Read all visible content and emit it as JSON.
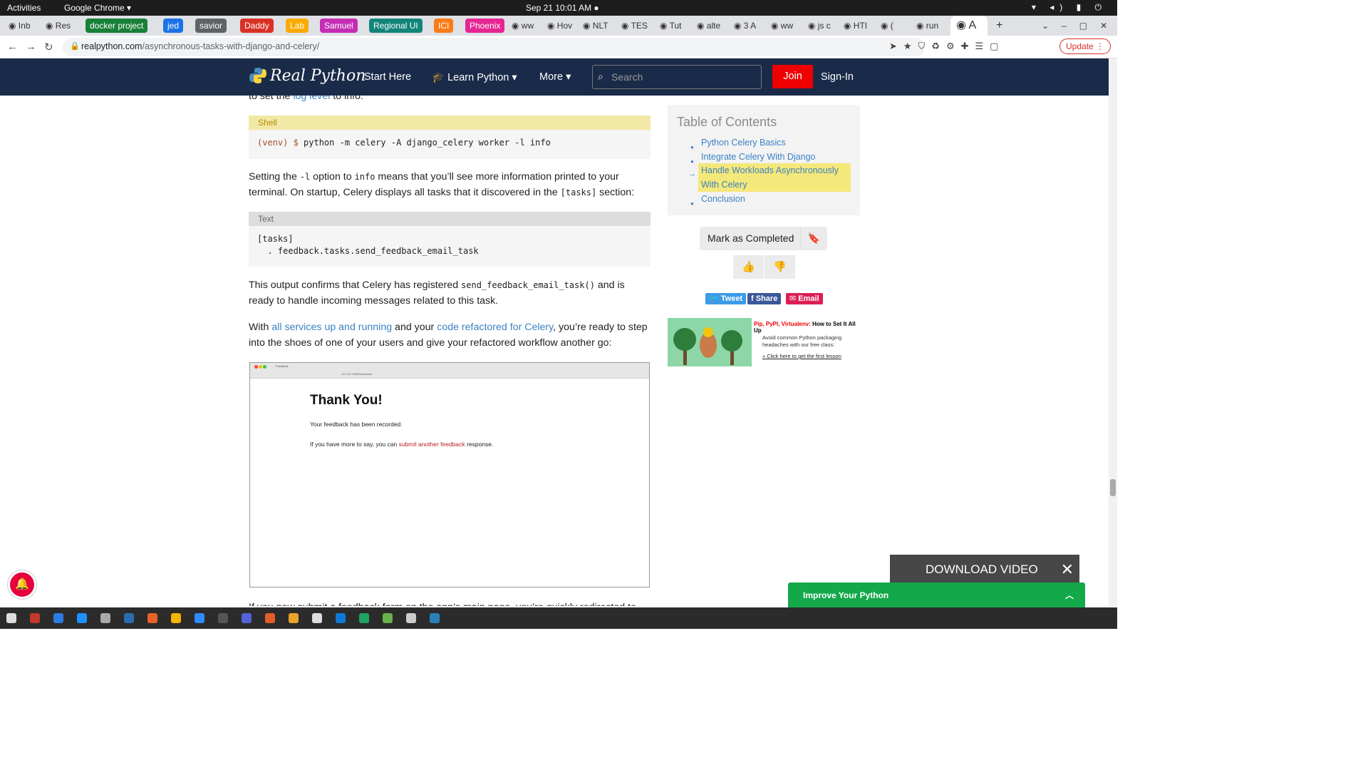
{
  "system": {
    "activities": "Activities",
    "app": "Google Chrome ▾",
    "clock": "Sep 21  10:01 AM  ●",
    "tray": "▾ ◂) ▮ ⏻"
  },
  "tabs": [
    {
      "label": "Inb",
      "icon": "gmail-icon"
    },
    {
      "label": "Res",
      "icon": "drive-icon"
    },
    {
      "label": "docker project",
      "group": true,
      "color": "#188038"
    },
    {
      "label": "jed",
      "group": true,
      "color": "#1a73e8"
    },
    {
      "label": "savior",
      "group": true,
      "color": "#5f6368"
    },
    {
      "label": "Daddy",
      "group": true,
      "color": "#d93025"
    },
    {
      "label": "Lab",
      "group": true,
      "color": "#f9ab00"
    },
    {
      "label": "Samuel",
      "group": true,
      "color": "#c42eb5"
    },
    {
      "label": "Regional UI",
      "group": true,
      "color": "#12857a"
    },
    {
      "label": "ICI",
      "group": true,
      "color": "#fa7b17"
    },
    {
      "label": "Phoenix",
      "group": true,
      "color": "#e52592"
    },
    {
      "label": "ww"
    },
    {
      "label": "Hov"
    },
    {
      "label": "NLT"
    },
    {
      "label": "TES"
    },
    {
      "label": "Tut"
    },
    {
      "label": "alte"
    },
    {
      "label": "3 A"
    },
    {
      "label": "ww"
    },
    {
      "label": "js c"
    },
    {
      "label": "HTI"
    },
    {
      "label": "("
    },
    {
      "label": "run"
    },
    {
      "label": "A"
    }
  ],
  "address": {
    "domain": "realpython.com",
    "path": "/asynchronous-tasks-with-django-and-celery/",
    "update": "Update"
  },
  "site": {
    "logo": "Real Python",
    "nav": [
      "Start Here",
      "Learn Python",
      "More"
    ],
    "search_placeholder": "Search",
    "join": "Join",
    "signin": "Sign-In"
  },
  "article": {
    "p0_pre": "to set the ",
    "p0_link": "log level",
    "p0_post": " to info:",
    "code1_label": "Shell",
    "code1": "(venv) $ python -m celery -A django_celery worker -l info",
    "p1_a": "Setting the ",
    "p1_code1": "-l",
    "p1_b": " option to ",
    "p1_code2": "info",
    "p1_c": " means that you’ll see more information printed to your terminal. On startup, Celery displays all tasks that it discovered in the ",
    "p1_code3": "[tasks]",
    "p1_d": " section:",
    "code2_label": "Text",
    "code2": "[tasks]\n  . feedback.tasks.send_feedback_email_task",
    "p2_a": "This output confirms that Celery has registered ",
    "p2_code": "send_feedback_email_task()",
    "p2_b": " and is ready to handle incoming messages related to this task.",
    "p3_a": "With ",
    "p3_link1": "all services up and running",
    "p3_b": " and your ",
    "p3_link2": "code refactored for Celery",
    "p3_c": ", you’re ready to step into the shoes of one of your users and give your refactored workflow another go:",
    "p4": "If you now submit a feedback form on the app’s main page, you’re quickly redirected to the"
  },
  "screenshot": {
    "tab": "Feedback",
    "url": "127.0.0.1:8000/success/",
    "heading": "Thank You!",
    "line1": "Your feedback has been recorded.",
    "line2_pre": "If you have more to say, you can ",
    "line2_link": "submit another feedback",
    "line2_post": " response."
  },
  "toc": {
    "title": "Table of Contents",
    "items": [
      "Python Celery Basics",
      "Integrate Celery With Django",
      "Handle Workloads Asynchronously",
      "With Celery",
      "Conclusion"
    ]
  },
  "sidebar": {
    "mark_completed": "Mark as Completed",
    "tweet": "Tweet",
    "share": "Share",
    "email": "Email",
    "ad_title_red": "Pip, PyPI, Virtualenv:",
    "ad_title": " How to Set It All Up",
    "ad_desc": "Avoid common Python packaging headaches with our free class:",
    "ad_link": "» Click here to get the first lesson"
  },
  "overlays": {
    "download_video": "DOWNLOAD VIDEO",
    "improve": "Improve Your Python"
  },
  "colors": {
    "navy": "#1a2b49",
    "join": "#ee0000",
    "green": "#13a84a",
    "highlight": "#f5e87a",
    "link": "#3b82c4"
  }
}
